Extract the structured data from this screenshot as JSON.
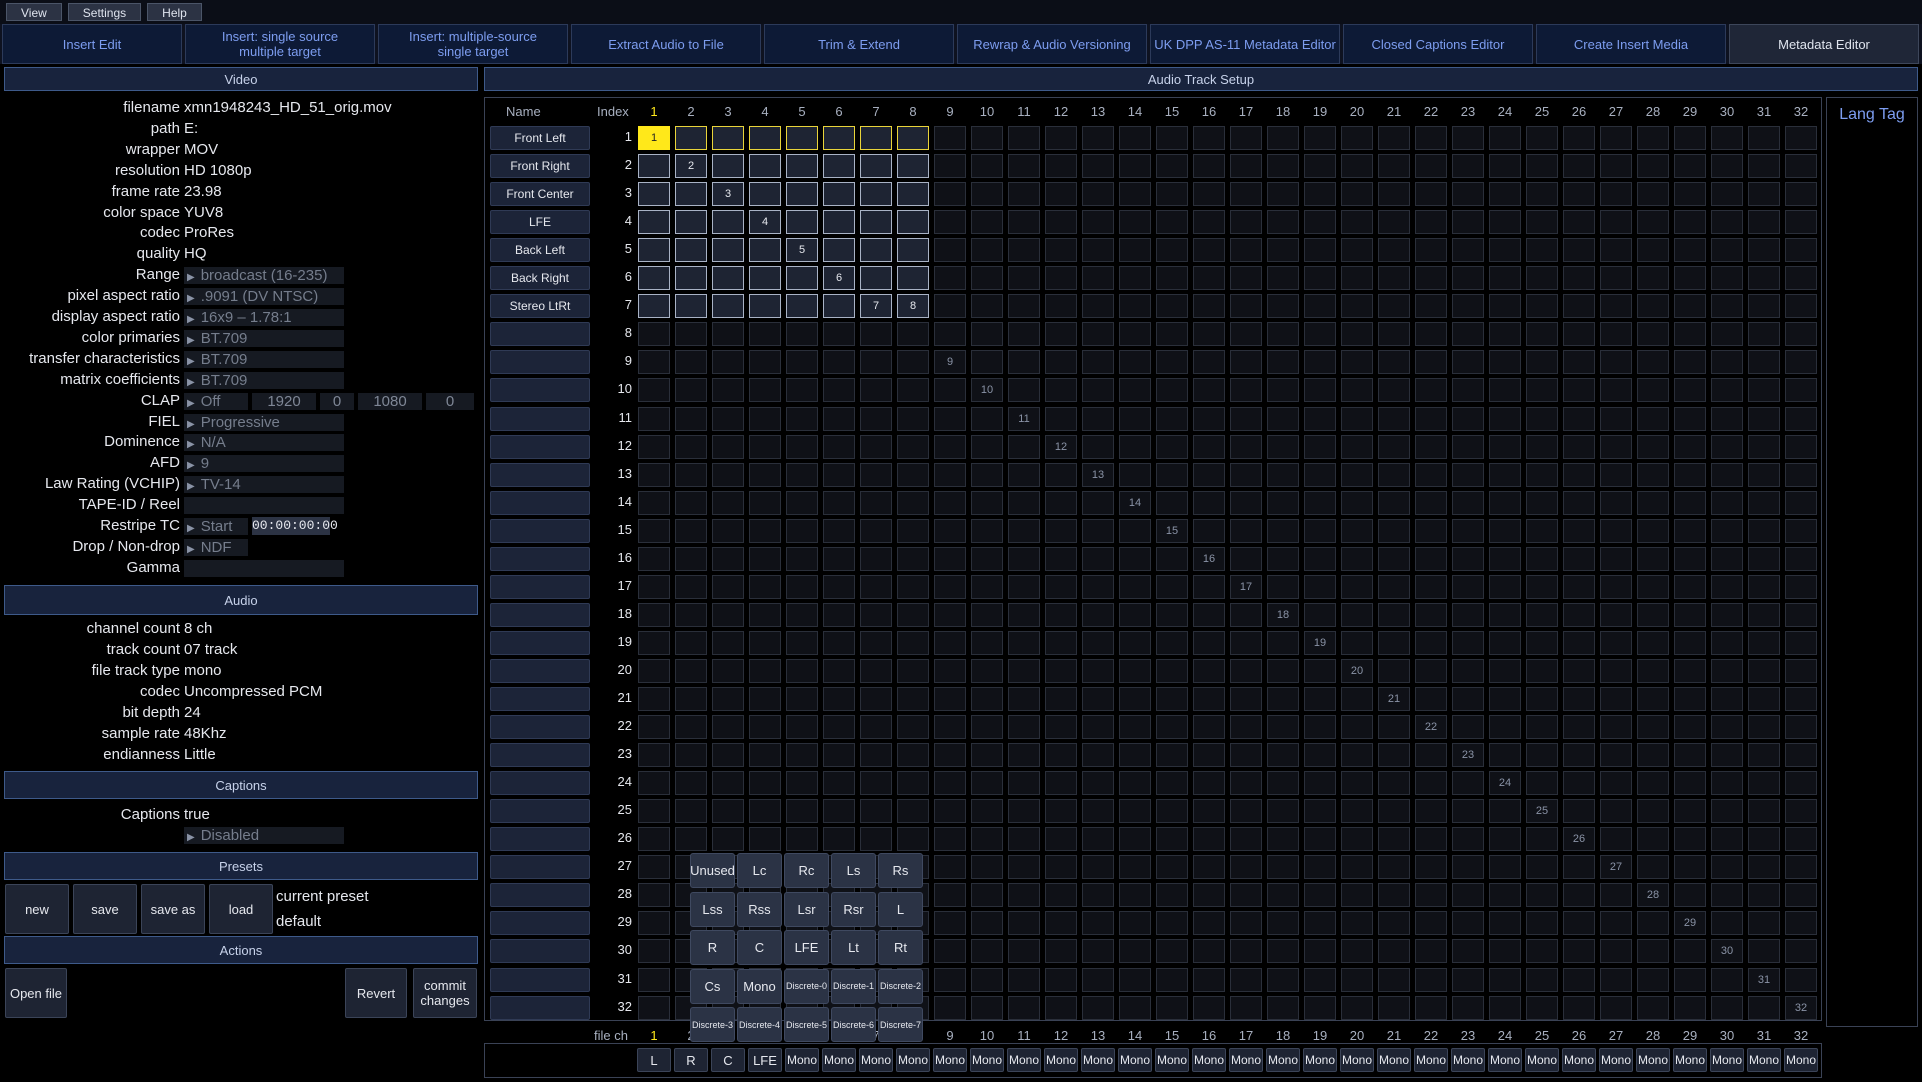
{
  "menu": [
    "View",
    "Settings",
    "Help"
  ],
  "tabs": [
    {
      "label": "Insert Edit"
    },
    {
      "label": "Insert: single source\nmultiple target"
    },
    {
      "label": "Insert: multiple-source\nsingle target"
    },
    {
      "label": "Extract Audio to File"
    },
    {
      "label": "Trim & Extend"
    },
    {
      "label": "Rewrap & Audio Versioning"
    },
    {
      "label": "UK DPP AS-11 Metadata Editor"
    },
    {
      "label": "Closed Captions Editor"
    },
    {
      "label": "Create Insert Media"
    },
    {
      "label": "Metadata Editor",
      "active": true
    }
  ],
  "video": {
    "header": "Video",
    "fields": [
      {
        "label": "filename",
        "value": "xmn1948243_HD_51_orig.mov"
      },
      {
        "label": "path",
        "value": "E:"
      },
      {
        "label": "wrapper",
        "value": "MOV"
      },
      {
        "label": "resolution",
        "value": "HD 1080p"
      },
      {
        "label": "frame rate",
        "value": "23.98"
      },
      {
        "label": "color space",
        "value": "YUV8"
      },
      {
        "label": "codec",
        "value": "ProRes"
      },
      {
        "label": "quality",
        "value": "HQ"
      },
      {
        "label": "Range",
        "dropdown": "broadcast (16-235)"
      },
      {
        "label": "pixel aspect ratio",
        "dropdown": ".9091 (DV NTSC)"
      },
      {
        "label": "display aspect ratio",
        "dropdown": "16x9 – 1.78:1"
      },
      {
        "label": "color primaries",
        "dropdown": "BT.709"
      },
      {
        "label": "transfer characteristics",
        "dropdown": "BT.709"
      },
      {
        "label": "matrix coefficients",
        "dropdown": "BT.709"
      },
      {
        "label": "CLAP",
        "dropdown": "Off",
        "clap": [
          "1920",
          "0",
          "1080",
          "0"
        ]
      },
      {
        "label": "FIEL",
        "dropdown": "Progressive"
      },
      {
        "label": "Dominence",
        "dropdown": "N/A"
      },
      {
        "label": "AFD",
        "dropdown": "9"
      },
      {
        "label": "Law Rating (VCHIP)",
        "dropdown": "TV-14"
      },
      {
        "label": "TAPE-ID / Reel",
        "dropdown": ""
      },
      {
        "label": "Restripe TC",
        "dropdown": "Start",
        "timecode": "00:00:00:00"
      },
      {
        "label": "Drop / Non-drop",
        "dropdown": "NDF"
      },
      {
        "label": "Gamma",
        "dropdown": ""
      }
    ]
  },
  "audio": {
    "header": "Audio",
    "fields": [
      {
        "label": "channel count",
        "value": "8 ch"
      },
      {
        "label": "track count",
        "value": "07 track"
      },
      {
        "label": "file track type",
        "value": "mono"
      },
      {
        "label": "codec",
        "value": "Uncompressed PCM"
      },
      {
        "label": "bit depth",
        "value": "24"
      },
      {
        "label": "sample rate",
        "value": "48Khz"
      },
      {
        "label": "endianness",
        "value": "Little"
      }
    ]
  },
  "captions": {
    "header": "Captions",
    "label": "Captions",
    "value": "true",
    "dropdown": "Disabled"
  },
  "presets": {
    "header": "Presets",
    "buttons": [
      "new",
      "save",
      "save as",
      "load"
    ],
    "current_label": "current preset",
    "current_value": "default"
  },
  "actions": {
    "header": "Actions",
    "open_file": "Open file",
    "revert": "Revert",
    "commit": "commit\nchanges"
  },
  "track_setup": {
    "header": "Audio Track Setup",
    "name_header": "Name",
    "index_header": "Index",
    "lang_tag": "Lang Tag",
    "file_ch_label": "file ch",
    "highlight_column": "1",
    "columns": [
      "1",
      "2",
      "3",
      "4",
      "5",
      "6",
      "7",
      "8",
      "9",
      "10",
      "11",
      "12",
      "13",
      "14",
      "15",
      "16",
      "17",
      "18",
      "19",
      "20",
      "21",
      "22",
      "23",
      "24",
      "25",
      "26",
      "27",
      "28",
      "29",
      "30",
      "31",
      "32"
    ],
    "tracks": [
      "Front Left",
      "Front Right",
      "Front Center",
      "LFE",
      "Back Left",
      "Back Right",
      "Stereo LtRt"
    ],
    "selected_cell": "1",
    "active_columns": 8,
    "assignments": [
      [
        "1",
        "1"
      ],
      [
        "2",
        "2"
      ],
      [
        "3",
        "3"
      ],
      [
        "4",
        "4"
      ],
      [
        "5",
        "5"
      ],
      [
        "6",
        "6"
      ],
      [
        "7",
        "7"
      ],
      [
        "7",
        "8"
      ]
    ],
    "channel_types": [
      "L",
      "R",
      "C",
      "LFE",
      "Mono",
      "Mono",
      "Mono",
      "Mono",
      "Mono",
      "Mono",
      "Mono",
      "Mono",
      "Mono",
      "Mono",
      "Mono",
      "Mono",
      "Mono",
      "Mono",
      "Mono",
      "Mono",
      "Mono",
      "Mono",
      "Mono",
      "Mono",
      "Mono",
      "Mono",
      "Mono",
      "Mono",
      "Mono",
      "Mono",
      "Mono",
      "Mono"
    ],
    "palette": [
      [
        "Unused",
        "Lc",
        "Rc",
        "Ls",
        "Rs"
      ],
      [
        "Lss",
        "Rss",
        "Lsr",
        "Rsr",
        "L"
      ],
      [
        "R",
        "C",
        "LFE",
        "Lt",
        "Rt"
      ],
      [
        "Cs",
        "Mono",
        "Discrete-0",
        "Discrete-1",
        "Discrete-2"
      ],
      [
        "Discrete-3",
        "Discrete-4",
        "Discrete-5",
        "Discrete-6",
        "Discrete-7"
      ]
    ]
  }
}
